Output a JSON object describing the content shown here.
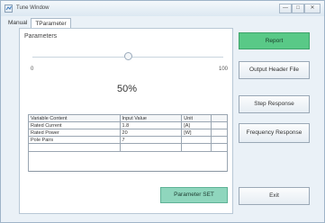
{
  "window": {
    "title": "Tune Window",
    "controls": [
      "—",
      "□",
      "✕"
    ]
  },
  "tabs": [
    {
      "label": "Manual",
      "active": false
    },
    {
      "label": "TParameter",
      "active": true
    }
  ],
  "parameters": {
    "label": "Parameters",
    "slider_min": "0",
    "slider_max": "100",
    "slider_value_fraction": 0.5,
    "percent_text": "50%"
  },
  "grid": {
    "headers": [
      "Variable Content",
      "Input Value",
      "Unit"
    ],
    "rows": [
      [
        "Rated Current",
        "1.8",
        "[A]"
      ],
      [
        "Rated Power",
        "20",
        "[W]"
      ],
      [
        "Pole Pairs",
        "7",
        ""
      ]
    ]
  },
  "buttons": {
    "report": "Report",
    "output_header_file": "Output Header File",
    "step_response": "Step Response",
    "frequency_response": "Frequency Response",
    "parameter_set": "Parameter SET",
    "exit": "Exit"
  },
  "colors": {
    "accent_green": "#59c987",
    "accent_teal": "#8fd6bd"
  }
}
